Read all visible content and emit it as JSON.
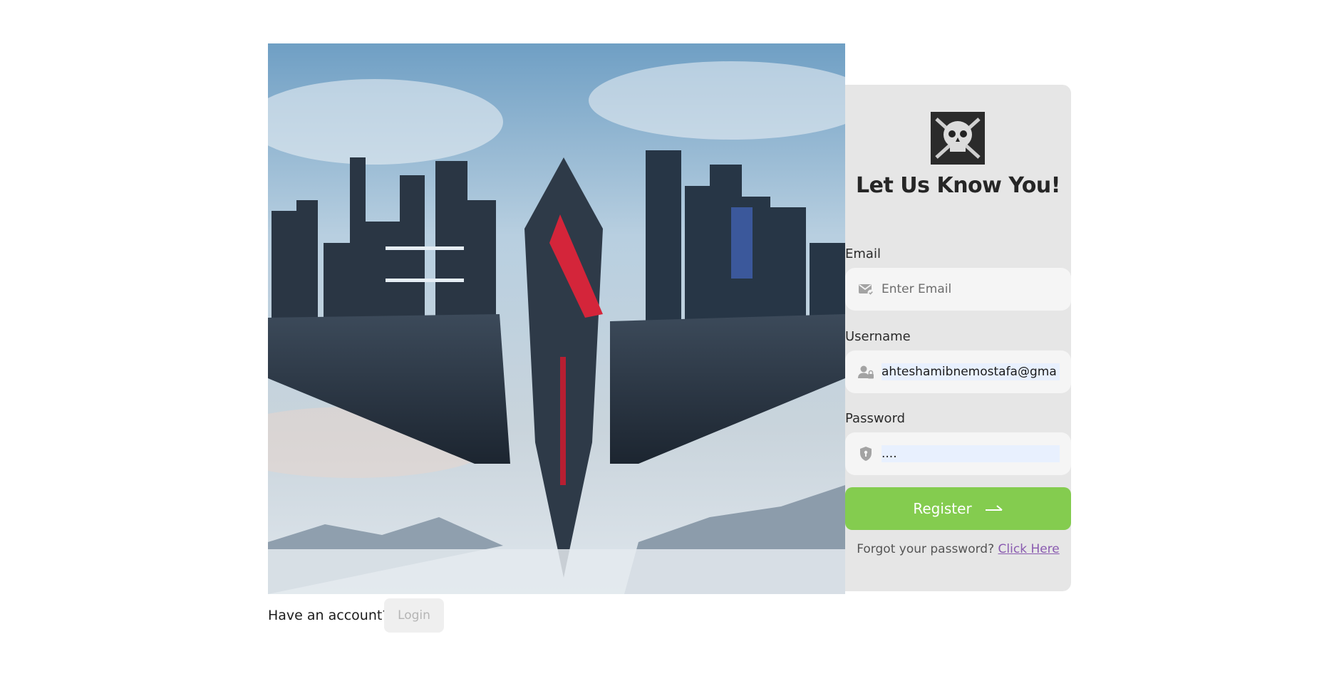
{
  "hero": {
    "image": "futuristic-floating-city-over-mountains"
  },
  "card": {
    "logo": "skull-crossbones-logo",
    "title": "Let Us Know You!",
    "email": {
      "label": "Email",
      "placeholder": "Enter Email",
      "value": "",
      "icon": "mail-check-icon"
    },
    "username": {
      "label": "Username",
      "value": "ahteshamibnemostafa@gma",
      "icon": "user-lock-icon"
    },
    "password": {
      "label": "Password",
      "value": "....",
      "icon": "shield-icon"
    },
    "register_label": "Register",
    "forgot_text": "Forgot your password?",
    "forgot_link": "Click Here"
  },
  "footer": {
    "have_account": "Have an account?",
    "login_label": "Login"
  },
  "colors": {
    "register_bg": "#84cc4f",
    "card_bg": "#e6e6e6",
    "link": "#8a5bb0"
  }
}
